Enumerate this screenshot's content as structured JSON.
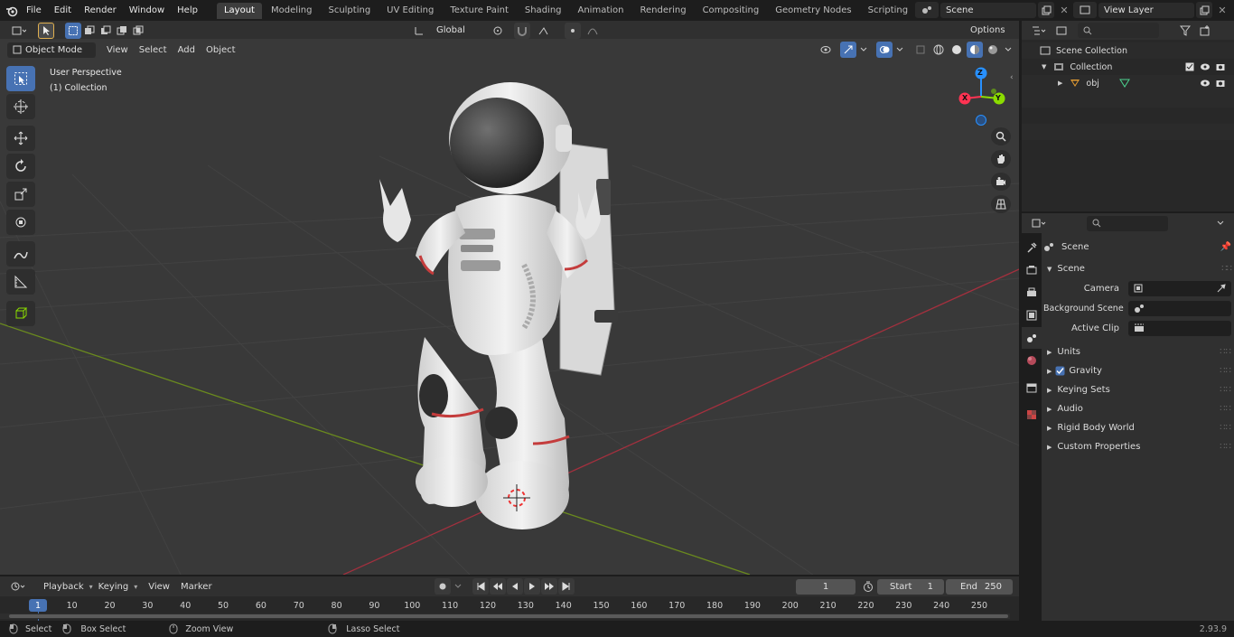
{
  "topbar": {
    "menus": [
      "File",
      "Edit",
      "Render",
      "Window",
      "Help"
    ],
    "workspaces": [
      "Layout",
      "Modeling",
      "Sculpting",
      "UV Editing",
      "Texture Paint",
      "Shading",
      "Animation",
      "Rendering",
      "Compositing",
      "Geometry Nodes",
      "Scripting"
    ],
    "active_workspace": "Layout",
    "scene_name": "Scene",
    "view_layer": "View Layer"
  },
  "viewport_header": {
    "mode": "Object Mode",
    "menus": [
      "View",
      "Select",
      "Add",
      "Object"
    ],
    "orientation": "Global",
    "options": "Options"
  },
  "viewport": {
    "perspective": "User Perspective",
    "collection": "(1) Collection",
    "gizmo": {
      "z": "Z",
      "y": "Y",
      "x": "X"
    }
  },
  "outliner": {
    "root": "Scene Collection",
    "collection": "Collection",
    "object": "obj"
  },
  "properties": {
    "header": "Scene",
    "section": "Scene",
    "fields": [
      {
        "label": "Camera"
      },
      {
        "label": "Background Scene"
      },
      {
        "label": "Active Clip"
      }
    ],
    "panels": [
      "Units",
      "Gravity",
      "Keying Sets",
      "Audio",
      "Rigid Body World",
      "Custom Properties"
    ]
  },
  "timeline": {
    "menus": [
      "Playback",
      "Keying",
      "View",
      "Marker"
    ],
    "current_frame": "1",
    "start_label": "Start",
    "start": "1",
    "end_label": "End",
    "end": "250",
    "ticks": [
      "1",
      "10",
      "20",
      "30",
      "40",
      "50",
      "60",
      "70",
      "80",
      "90",
      "100",
      "110",
      "120",
      "130",
      "140",
      "150",
      "160",
      "170",
      "180",
      "190",
      "200",
      "210",
      "220",
      "230",
      "240",
      "250"
    ]
  },
  "statusbar": {
    "items": [
      "Select",
      "Box Select",
      "Zoom View",
      "Lasso Select"
    ],
    "version": "2.93.9"
  },
  "colors": {
    "accent": "#4772b3",
    "viewport_bg": "#393939",
    "x_axis": "#ff3352",
    "y_axis": "#8bdc00",
    "z_axis": "#2890ff"
  }
}
